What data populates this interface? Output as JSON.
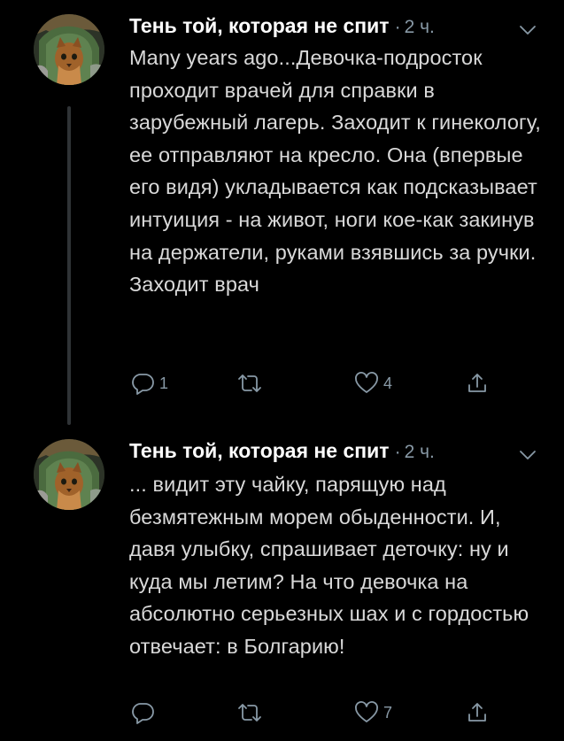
{
  "tweets": [
    {
      "author": "Тень той, которая не спит",
      "time_separator": "·",
      "time": "2 ч.",
      "text": "Many years ago...Девочка-подросток проходит врачей для справки в зарубежный лагерь. Заходит к гинекологу, ее отправляют на кресло. Она (впервые его видя) укладывается как подсказывает интуиция - на живот, ноги кое-как закинув на держатели, руками взявшись за ручки. Заходит врач",
      "reply_count": "1",
      "retweet_count": "",
      "like_count": "4"
    },
    {
      "author": "Тень той, которая не спит",
      "time_separator": "·",
      "time": "2 ч.",
      "text": "... видит эту чайку, парящую над безмятежным морем обыденности. И, давя улыбку, спрашивает деточку: ну и куда мы летим? На что девочка на абсолютно серьезных шах и с гордостью отвечает: в Болгарию!",
      "reply_count": "",
      "retweet_count": "",
      "like_count": "7"
    }
  ],
  "icons": {
    "avatar": "avatar-cat-image",
    "caret": "chevron-down-icon",
    "reply": "reply-icon",
    "retweet": "retweet-icon",
    "like": "heart-icon",
    "share": "share-icon"
  },
  "colors": {
    "background": "#000000",
    "name": "#ffffff",
    "body_text": "#d9d9d9",
    "muted": "#8899a6",
    "thread_line": "#2f3336"
  }
}
